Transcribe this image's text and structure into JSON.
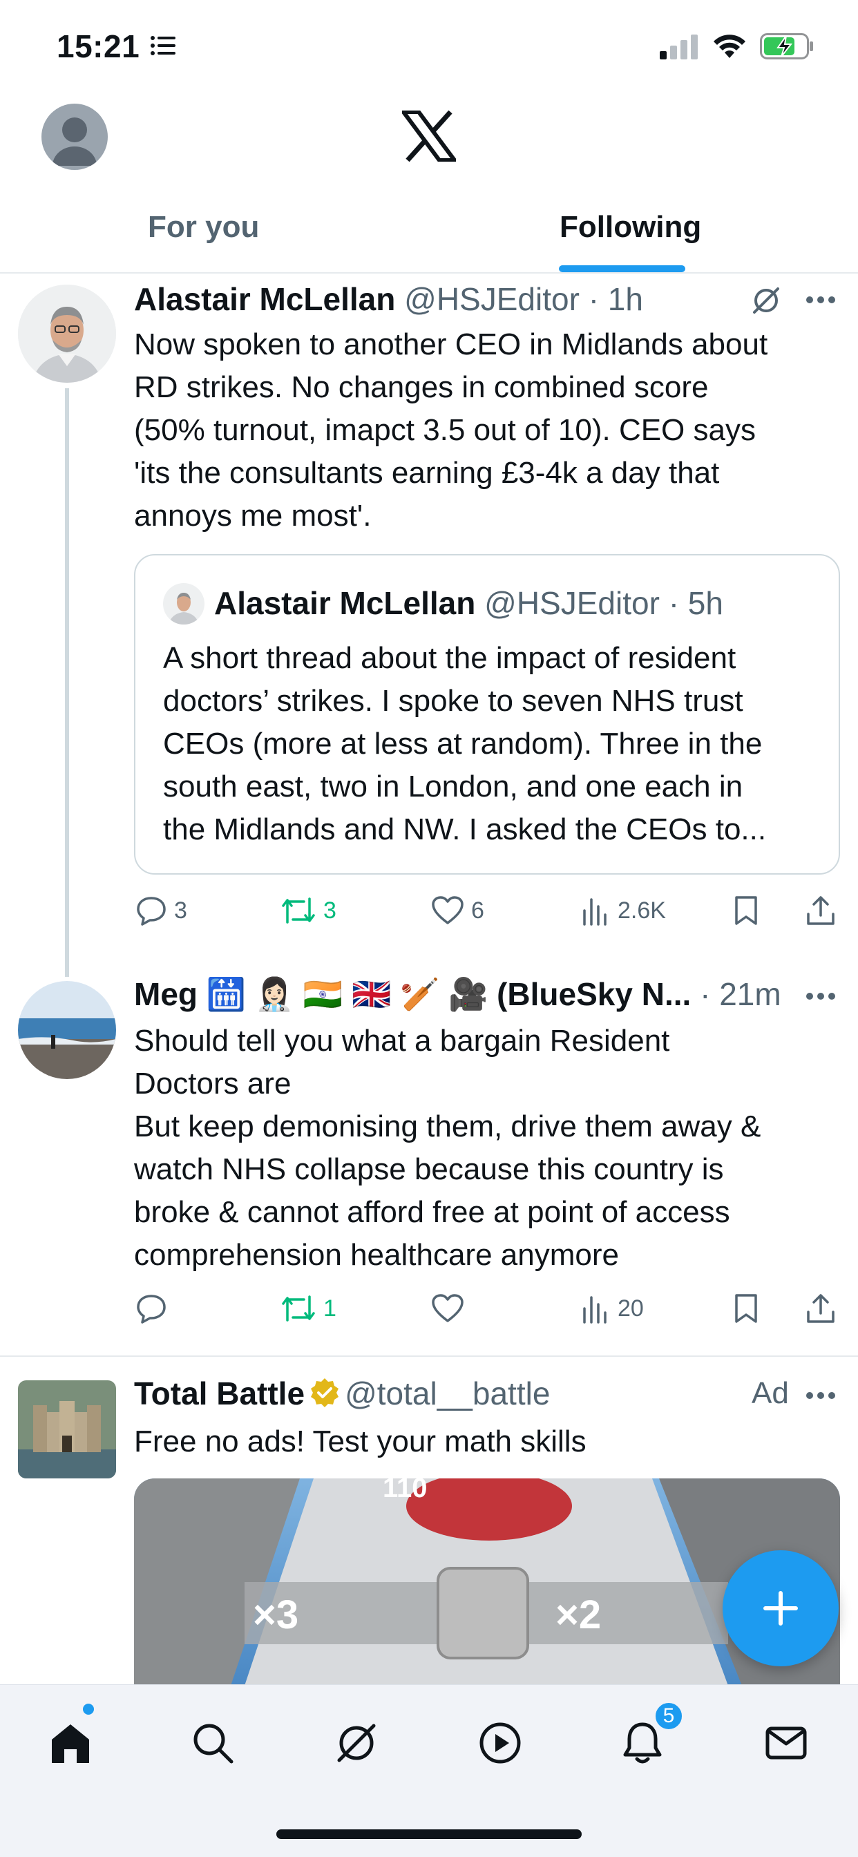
{
  "status_bar": {
    "time": "15:21"
  },
  "header": {
    "tabs": [
      {
        "label": "For you",
        "selected": false
      },
      {
        "label": "Following",
        "selected": true
      }
    ]
  },
  "feed": [
    {
      "name": "Alastair McLellan",
      "handle": "@HSJEditor",
      "time": "· 1h",
      "text_lines": [
        "Now spoken to another CEO in Midlands about",
        "RD strikes. No changes in combined score",
        "(50% turnout, imapct 3.5 out of 10). CEO says",
        "'its the consultants earning £3-4k a day that",
        "annoys me most'."
      ],
      "quote": {
        "name": "Alastair McLellan",
        "handle": "@HSJEditor",
        "time": "· 5h",
        "text_lines": [
          "A short thread about the impact of resident",
          "doctors’ strikes. I spoke to seven NHS trust",
          "CEOs (more at less at random). Three in the",
          "south east, two in London, and one each in",
          "the Midlands and NW. I asked the CEOs to..."
        ]
      },
      "replies": "3",
      "reposts": "3",
      "likes": "6",
      "views": "2.6K"
    },
    {
      "name": "Meg 🛗 👩🏻‍⚕️ 🇮🇳 🇬🇧 🏏 🎥 (BlueSky N...",
      "time": "· 21m",
      "text_lines": [
        "Should tell you what a bargain Resident",
        "Doctors are",
        "But keep demonising them, drive them away &",
        "watch NHS collapse because this country is",
        "broke & cannot afford free at point of access",
        "comprehension healthcare anymore"
      ],
      "replies": "",
      "reposts": "1",
      "likes": "",
      "views": "20"
    },
    {
      "name": "Total Battle",
      "handle": "@total__battle",
      "ad_label": "Ad",
      "text": "Free no ads! Test your math skills",
      "media_labels": {
        "number": "110",
        "left": "×3",
        "right": "×2"
      }
    }
  ],
  "bottom_nav": {
    "notifications_badge": "5"
  },
  "colors": {
    "accent": "#1d9bf0",
    "repost_green": "#00ba7c",
    "muted": "#536471"
  }
}
